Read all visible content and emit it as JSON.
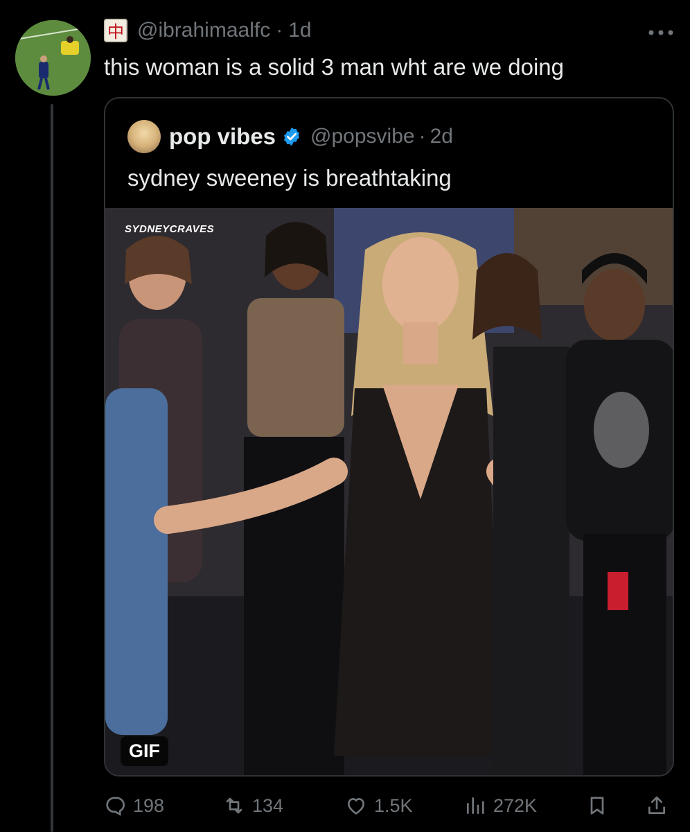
{
  "tweet": {
    "avatar_icon": "profile-avatar",
    "flair_icon": "mahjong-red-dragon-icon",
    "flair_glyph": "中",
    "handle": "@ibrahimaalfc",
    "separator": "·",
    "time": "1d",
    "text": "this woman is a solid 3 man wht are we doing",
    "more_icon": "ellipsis-icon"
  },
  "quote": {
    "name": "pop vibes",
    "verified_icon": "verified-badge-icon",
    "handle": "@popsvibe",
    "separator": "·",
    "time": "2d",
    "text": "sydney sweeney is breathtaking",
    "media": {
      "watermark": "SYDNEYCRAVES",
      "badge": "GIF"
    }
  },
  "actions": {
    "reply": {
      "icon": "reply-icon",
      "count": "198"
    },
    "retweet": {
      "icon": "retweet-icon",
      "count": "134"
    },
    "like": {
      "icon": "heart-icon",
      "count": "1.5K"
    },
    "views": {
      "icon": "views-icon",
      "count": "272K"
    },
    "bookmark": {
      "icon": "bookmark-icon"
    },
    "share": {
      "icon": "share-icon"
    }
  },
  "colors": {
    "background": "#000000",
    "text": "#e7e9ea",
    "muted": "#71767b",
    "border": "#2f3336",
    "verified": "#1d9bf0"
  }
}
